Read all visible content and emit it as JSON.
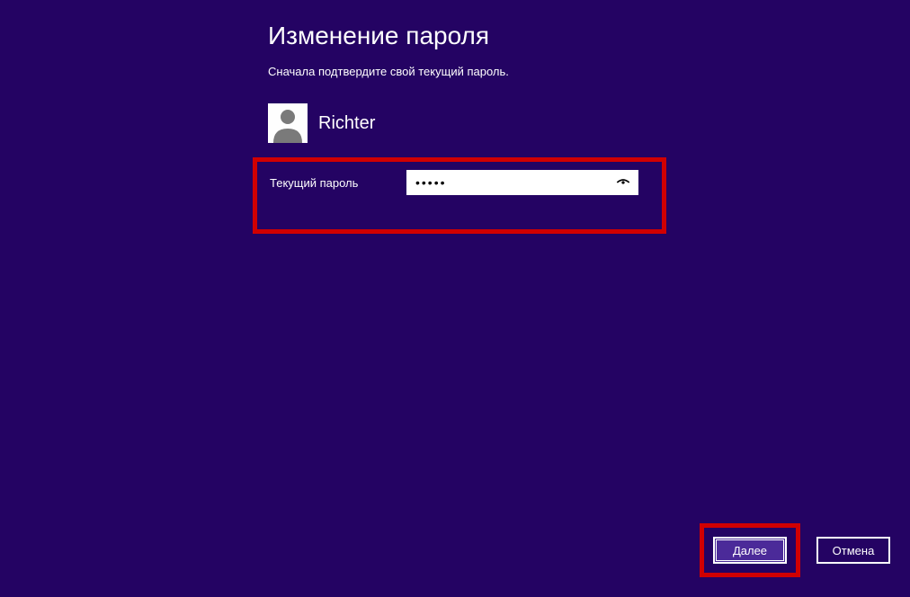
{
  "title": "Изменение пароля",
  "instruction": "Сначала подтвердите свой текущий пароль.",
  "user": {
    "name": "Richter"
  },
  "form": {
    "current_password_label": "Текущий пароль",
    "current_password_value": "•••••"
  },
  "buttons": {
    "next": "Далее",
    "cancel": "Отмена"
  }
}
